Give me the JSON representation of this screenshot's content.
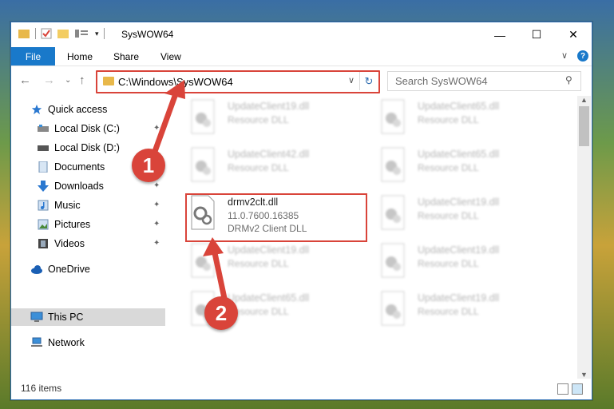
{
  "window": {
    "title": "SysWOW64",
    "minimize": "—",
    "maximize": "☐",
    "close": "✕"
  },
  "ribbon": {
    "file": "File",
    "tabs": [
      "Home",
      "Share",
      "View"
    ],
    "help": "?"
  },
  "address": {
    "path": "C:\\Windows\\SysWOW64",
    "search_placeholder": "Search SysWOW64"
  },
  "sidebar": {
    "items": [
      {
        "label": "Quick access",
        "icon": "star-icon"
      },
      {
        "label": "Local Disk (C:)",
        "icon": "drive-icon"
      },
      {
        "label": "Local Disk (D:)",
        "icon": "drive-icon"
      },
      {
        "label": "Documents",
        "icon": "documents-icon"
      },
      {
        "label": "Downloads",
        "icon": "download-icon"
      },
      {
        "label": "Music",
        "icon": "music-icon"
      },
      {
        "label": "Pictures",
        "icon": "pictures-icon"
      },
      {
        "label": "Videos",
        "icon": "videos-icon"
      },
      {
        "label": "OneDrive",
        "icon": "cloud-icon"
      },
      {
        "label": "This PC",
        "icon": "computer-icon"
      },
      {
        "label": "Network",
        "icon": "network-icon"
      }
    ]
  },
  "files": {
    "left": [
      {
        "name": "UpdateClient19.dll",
        "sub": "Resource DLL"
      },
      {
        "name": "UpdateClient42.dll",
        "sub": "Resource DLL"
      },
      {
        "name": "drmv2clt.dll",
        "version": "11.0.7600.16385",
        "sub": "DRMv2 Client DLL"
      },
      {
        "name": "UpdateClient19.dll",
        "sub": "Resource DLL"
      },
      {
        "name": "UpdateClient65.dll",
        "sub": "Resource DLL"
      }
    ],
    "right": [
      {
        "name": "UpdateClient65.dll",
        "sub": "Resource DLL"
      },
      {
        "name": "UpdateClient65.dll",
        "sub": "Resource DLL"
      },
      {
        "name": "UpdateClient19.dll",
        "sub": "Resource DLL"
      },
      {
        "name": "UpdateClient19.dll",
        "sub": "Resource DLL"
      },
      {
        "name": "UpdateClient19.dll",
        "sub": "Resource DLL"
      }
    ]
  },
  "status": {
    "count": "116 items"
  },
  "markers": {
    "one": "1",
    "two": "2"
  },
  "colors": {
    "accent": "#1979ca",
    "highlight": "#d9443a"
  }
}
